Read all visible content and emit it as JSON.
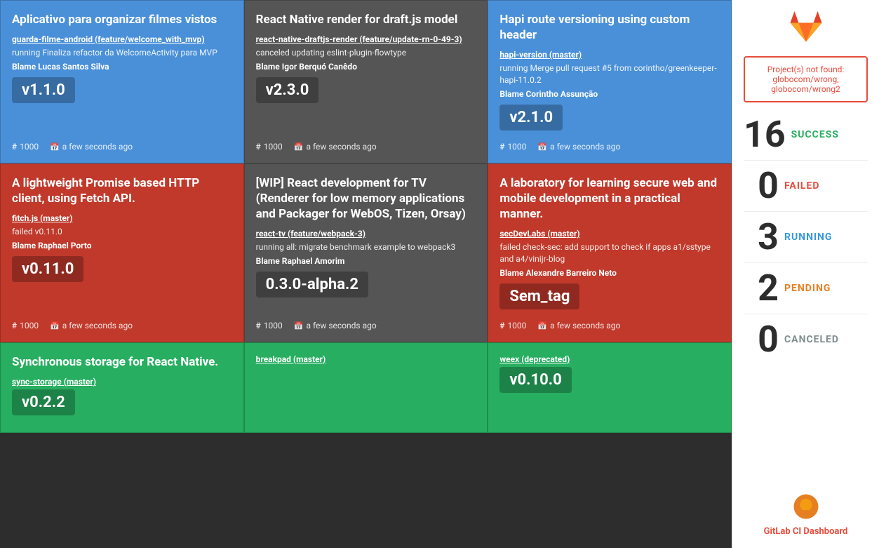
{
  "cards": [
    {
      "id": "card-1",
      "status": "blue",
      "title": "Aplicativo para organizar filmes vistos",
      "repo": "guarda-filme-android (feature/welcome_with_mvp)",
      "description": "running Finaliza refactor da WelcomeActivity para MVP",
      "blame": "Blame Lucas Santos Silva",
      "version": "v1.1.0",
      "issue": "1000",
      "time": "a few seconds ago"
    },
    {
      "id": "card-2",
      "status": "gray",
      "title": "React Native render for draft.js model",
      "repo": "react-native-draftjs-render (feature/update-rn-0-49-3)",
      "description": "canceled updating eslint-plugin-flowtype",
      "blame": "Blame Igor Berquó Canêdo",
      "version": "v2.3.0",
      "issue": "1000",
      "time": "a few seconds ago"
    },
    {
      "id": "card-3",
      "status": "blue",
      "title": "Hapi route versioning using custom header",
      "repo": "hapi-version (master)",
      "description": "running Merge pull request #5 from corintho/greenkeeper-hapi-11.0.2",
      "blame": "Blame Corintho Assunção",
      "version": "v2.1.0",
      "issue": "1000",
      "time": "a few seconds ago"
    },
    {
      "id": "card-4",
      "status": "red",
      "title": "A lightweight Promise based HTTP client, using Fetch API.",
      "repo": "fitch.js (master)",
      "description": "failed v0.11.0",
      "blame": "Blame Raphael Porto",
      "version": "v0.11.0",
      "issue": "1000",
      "time": "a few seconds ago"
    },
    {
      "id": "card-5",
      "status": "gray",
      "title": "[WIP] React development for TV (Renderer for low memory applications and Packager for WebOS, Tizen, Orsay)",
      "repo": "react-tv (feature/webpack-3)",
      "description": "running all: migrate benchmark example to webpack3",
      "blame": "Blame Raphael Amorim",
      "version": "0.3.0-alpha.2",
      "issue": "1000",
      "time": "a few seconds ago"
    },
    {
      "id": "card-6",
      "status": "red",
      "title": "A laboratory for learning secure web and mobile development in a practical manner.",
      "repo": "secDevLabs (master)",
      "description": "failed check-sec: add support to check if apps a1/sstype and a4/vinijr-blog",
      "blame": "Blame Alexandre Barreiro Neto",
      "version": "Sem_tag",
      "issue": "1000",
      "time": "a few seconds ago"
    },
    {
      "id": "card-7",
      "status": "green",
      "title": "Synchronous storage for React Native.",
      "repo": "sync-storage (master)",
      "description": "",
      "blame": "",
      "version": "v0.2.2",
      "issue": "",
      "time": ""
    },
    {
      "id": "card-8",
      "status": "green",
      "title": "",
      "repo": "breakpad (master)",
      "description": "",
      "blame": "",
      "version": "",
      "issue": "",
      "time": ""
    },
    {
      "id": "card-9",
      "status": "green",
      "title": "",
      "repo": "weex (deprecated)",
      "description": "",
      "blame": "",
      "version": "v0.10.0",
      "issue": "",
      "time": ""
    }
  ],
  "sidebar": {
    "error": "Project(s) not found: globocom/wrong, globocom/wrong2",
    "stats": [
      {
        "id": "success",
        "number": "16",
        "label": "SUCCESS",
        "class": "success"
      },
      {
        "id": "failed",
        "number": "0",
        "label": "FAILED",
        "class": "failed"
      },
      {
        "id": "running",
        "number": "3",
        "label": "RUNNING",
        "class": "running"
      },
      {
        "id": "pending",
        "number": "2",
        "label": "PENDING",
        "class": "pending"
      },
      {
        "id": "canceled",
        "number": "0",
        "label": "CANCELED",
        "class": "canceled"
      }
    ],
    "footer_label": "GitLab CI Dashboard"
  }
}
